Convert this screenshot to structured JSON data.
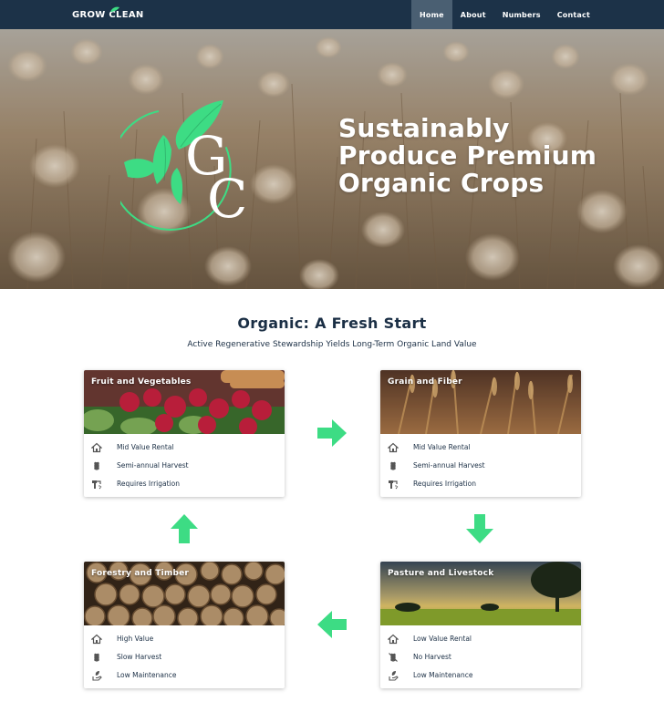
{
  "nav": {
    "brand": "GROW CLEAN",
    "items": [
      {
        "label": "Home",
        "active": true
      },
      {
        "label": "About",
        "active": false
      },
      {
        "label": "Numbers",
        "active": false
      },
      {
        "label": "Contact",
        "active": false
      }
    ]
  },
  "hero": {
    "logo_text": "GC",
    "title_lines": [
      "Sustainably",
      "Produce Premium",
      "Organic Crops"
    ]
  },
  "section": {
    "title": "Organic: A Fresh Start",
    "subtitle": "Active Regenerative Stewardship Yields Long-Term Organic Land Value"
  },
  "cards": [
    {
      "title": "Fruit and Vegetables",
      "features": [
        {
          "icon": "house-icon",
          "text": "Mid Value Rental"
        },
        {
          "icon": "wheat-icon",
          "text": "Semi-annual Harvest"
        },
        {
          "icon": "irrigation-icon",
          "text": "Requires Irrigation"
        }
      ]
    },
    {
      "title": "Grain and Fiber",
      "features": [
        {
          "icon": "house-icon",
          "text": "Mid Value Rental"
        },
        {
          "icon": "wheat-icon",
          "text": "Semi-annual Harvest"
        },
        {
          "icon": "irrigation-icon",
          "text": "Requires Irrigation"
        }
      ]
    },
    {
      "title": "Forestry and Timber",
      "features": [
        {
          "icon": "house-icon",
          "text": "High Value"
        },
        {
          "icon": "wheat-icon",
          "text": "Slow Harvest"
        },
        {
          "icon": "hand-leaf-icon",
          "text": "Low Maintenance"
        }
      ]
    },
    {
      "title": "Pasture and Livestock",
      "features": [
        {
          "icon": "house-icon",
          "text": "Low Value Rental"
        },
        {
          "icon": "no-wheat-icon",
          "text": "No Harvest"
        },
        {
          "icon": "hand-leaf-icon",
          "text": "Low Maintenance"
        }
      ]
    }
  ],
  "colors": {
    "nav": "#1c3248",
    "accent": "#3ddc84",
    "text": "#1b2f45"
  }
}
